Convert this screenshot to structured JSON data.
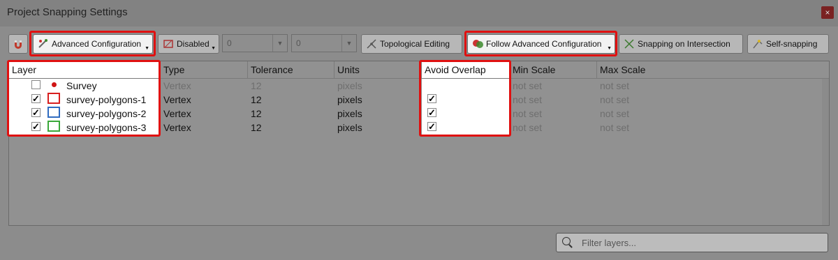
{
  "window": {
    "title": "Project Snapping Settings",
    "close_label": "×"
  },
  "toolbar": {
    "mode_label": "Advanced Configuration",
    "type_label": "Disabled",
    "tolerance_value": "0",
    "units_value": "0",
    "topological_label": "Topological Editing",
    "avoid_mode_label": "Follow Advanced Configuration",
    "intersection_label": "Snapping on Intersection",
    "self_snap_label": "Self-snapping"
  },
  "table": {
    "headers": [
      "Layer",
      "Type",
      "Tolerance",
      "Units",
      "Avoid Overlap",
      "Min Scale",
      "Max Scale"
    ],
    "rows": [
      {
        "name": "Survey",
        "type": "Vertex",
        "tolerance": "12",
        "units": "pixels",
        "min": "not set",
        "max": "not set",
        "checked": false,
        "avoid": false,
        "style": "point",
        "color": "#d01515"
      },
      {
        "name": "survey-polygons-1",
        "type": "Vertex",
        "tolerance": "12",
        "units": "pixels",
        "min": "not set",
        "max": "not set",
        "checked": true,
        "avoid": true,
        "style": "polygon",
        "color": "#d81f1f"
      },
      {
        "name": "survey-polygons-2",
        "type": "Vertex",
        "tolerance": "12",
        "units": "pixels",
        "min": "not set",
        "max": "not set",
        "checked": true,
        "avoid": true,
        "style": "polygon",
        "color": "#2f6bc0"
      },
      {
        "name": "survey-polygons-3",
        "type": "Vertex",
        "tolerance": "12",
        "units": "pixels",
        "min": "not set",
        "max": "not set",
        "checked": true,
        "avoid": true,
        "style": "polygon",
        "color": "#3aa83a"
      }
    ]
  },
  "filter": {
    "placeholder": "Filter layers..."
  },
  "colors": {
    "highlight": "#e01010"
  }
}
